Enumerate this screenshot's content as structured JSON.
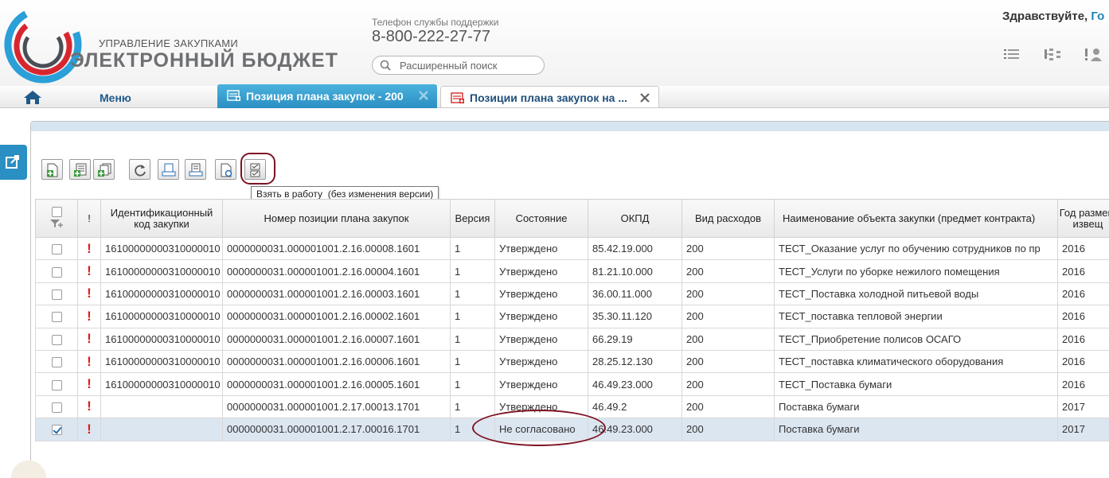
{
  "header": {
    "brand_small": "УПРАВЛЕНИЕ ЗАКУПКАМИ",
    "brand_big": "ЭЛЕКТРОННЫЙ БЮДЖЕТ",
    "support_label": "Телефон службы поддержки",
    "support_phone": "8-800-222-27-77",
    "search_placeholder": "Расширенный поиск",
    "greeting": "Здравствуйте,",
    "user_fragment": "Го",
    "icons": [
      "list-icon",
      "tree-icon",
      "user-list-icon"
    ]
  },
  "tabs_bar": {
    "menu_label": "Меню",
    "tabs": [
      {
        "label": "Позиция плана закупок - 200",
        "active": true
      },
      {
        "label": "Позиции плана закупок на ...",
        "active": false
      }
    ]
  },
  "toolbar": {
    "buttons": [
      "add-icon",
      "add-list-icon",
      "copy-icon",
      "refresh-icon",
      "print-icon",
      "print-form-icon",
      "preview-icon",
      "take-to-work-icon"
    ],
    "tooltip": "Взять в работу  (без изменения версии)"
  },
  "grid": {
    "columns": [
      "",
      "!",
      "Идентификационный код закупки",
      "Номер позиции плана закупок",
      "Версия",
      "Состояние",
      "ОКПД",
      "Вид расходов",
      "Наименование объекта закупки (предмет контракта)",
      "Год размещ извещ"
    ],
    "rows": [
      {
        "checked": false,
        "code": "16100000000310000010",
        "number": "0000000031.000001001.2.16.00008.1601",
        "version": "1",
        "state": "Утверждено",
        "okpd": "85.42.19.000",
        "expense": "200",
        "name": "ТЕСТ_Оказание услуг по обучению сотрудников по пр",
        "year": "2016"
      },
      {
        "checked": false,
        "code": "16100000000310000010",
        "number": "0000000031.000001001.2.16.00004.1601",
        "version": "1",
        "state": "Утверждено",
        "okpd": "81.21.10.000",
        "expense": "200",
        "name": "ТЕСТ_Услуги по уборке нежилого помещения",
        "year": "2016"
      },
      {
        "checked": false,
        "code": "16100000000310000010",
        "number": "0000000031.000001001.2.16.00003.1601",
        "version": "1",
        "state": "Утверждено",
        "okpd": "36.00.11.000",
        "expense": "200",
        "name": "ТЕСТ_Поставка холодной питьевой воды",
        "year": "2016"
      },
      {
        "checked": false,
        "code": "16100000000310000010",
        "number": "0000000031.000001001.2.16.00002.1601",
        "version": "1",
        "state": "Утверждено",
        "okpd": "35.30.11.120",
        "expense": "200",
        "name": "ТЕСТ_поставка тепловой энергии",
        "year": "2016"
      },
      {
        "checked": false,
        "code": "16100000000310000010",
        "number": "0000000031.000001001.2.16.00007.1601",
        "version": "1",
        "state": "Утверждено",
        "okpd": "66.29.19",
        "expense": "200",
        "name": "ТЕСТ_Приобретение полисов ОСАГО",
        "year": "2016"
      },
      {
        "checked": false,
        "code": "16100000000310000010",
        "number": "0000000031.000001001.2.16.00006.1601",
        "version": "1",
        "state": "Утверждено",
        "okpd": "28.25.12.130",
        "expense": "200",
        "name": "ТЕСТ_поставка климатического оборудования",
        "year": "2016"
      },
      {
        "checked": false,
        "code": "16100000000310000010",
        "number": "0000000031.000001001.2.16.00005.1601",
        "version": "1",
        "state": "Утверждено",
        "okpd": "46.49.23.000",
        "expense": "200",
        "name": "ТЕСТ_Поставка бумаги",
        "year": "2016"
      },
      {
        "checked": false,
        "code": "",
        "number": "0000000031.000001001.2.17.00013.1701",
        "version": "1",
        "state": "Утверждено",
        "okpd": "46.49.2",
        "expense": "200",
        "name": "Поставка бумаги",
        "year": "2017"
      },
      {
        "checked": true,
        "code": "",
        "number": "0000000031.000001001.2.17.00016.1701",
        "version": "1",
        "state": "Не согласовано",
        "okpd": "46.49.23.000",
        "expense": "200",
        "name": "Поставка бумаги",
        "year": "2017"
      }
    ]
  },
  "colors": {
    "accent": "#2b8fc2",
    "warning": "#e01b1b",
    "annotation": "#7d1323",
    "selected_row": "#dce6f1"
  }
}
